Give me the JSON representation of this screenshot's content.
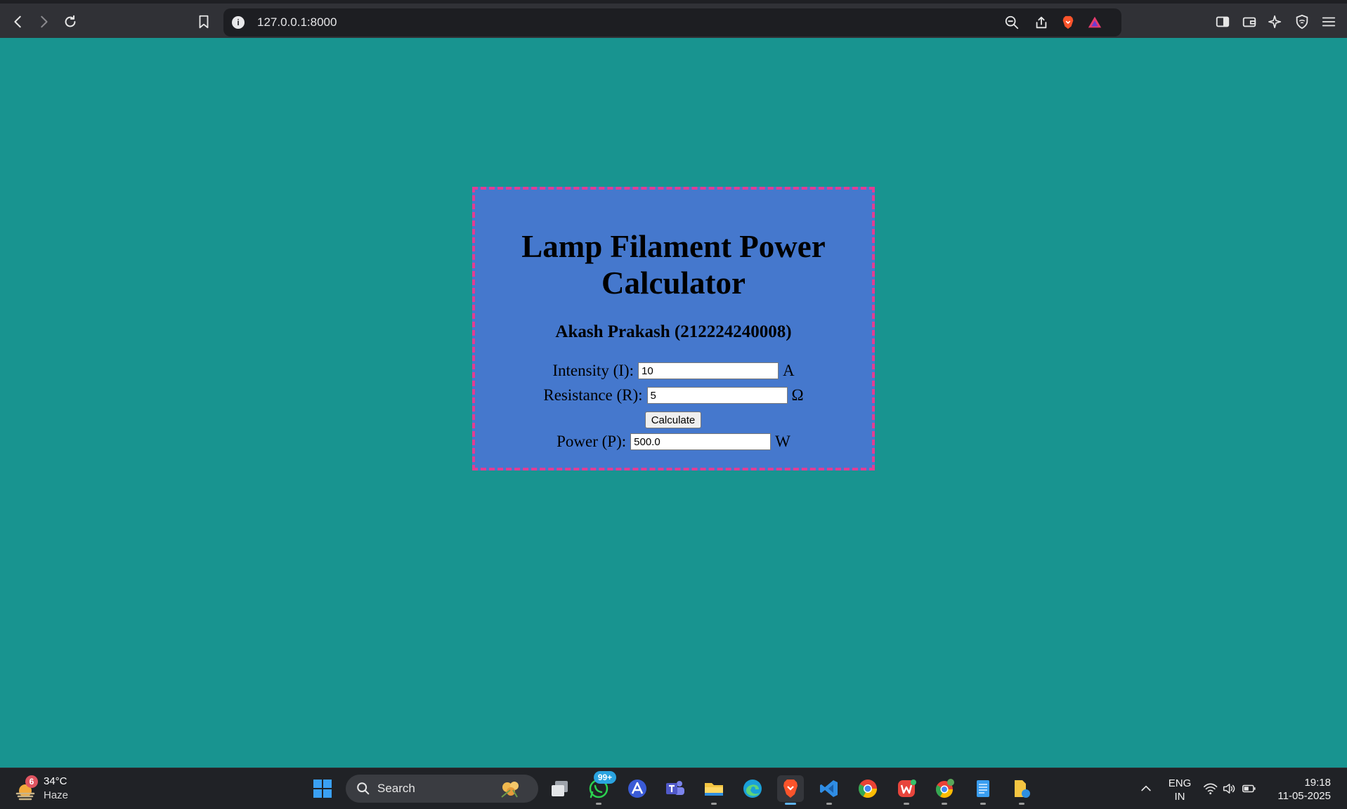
{
  "browser": {
    "url": "127.0.0.1:8000",
    "colors": {
      "frame": "#303136",
      "urlbar": "#1d1e22"
    }
  },
  "page": {
    "background": "#189490",
    "title": "Lamp Filament Power Calculator",
    "author": "Akash Prakash (212224240008)",
    "intensity": {
      "label": "Intensity (I):",
      "value": "10",
      "unit": "A"
    },
    "resistance": {
      "label": "Resistance (R):",
      "value": "5",
      "unit": "Ω"
    },
    "calculate_label": "Calculate",
    "power": {
      "label": "Power (P):",
      "value": "500.0",
      "unit": "W"
    },
    "colors": {
      "card": "#4578cd",
      "border": "#e23d93"
    }
  },
  "taskbar": {
    "weather": {
      "badge": "6",
      "temp": "34°C",
      "condition": "Haze"
    },
    "search_label": "Search",
    "whatsapp_badge": "99+",
    "language": {
      "line1": "ENG",
      "line2": "IN"
    },
    "clock": {
      "time": "19:18",
      "date": "11-05-2025"
    },
    "apps": [
      "task-view-icon",
      "whatsapp-icon",
      "arc-icon",
      "teams-icon",
      "file-explorer-icon",
      "edge-icon",
      "brave-icon",
      "vscode-icon",
      "chrome-icon",
      "wps-icon",
      "chrome-profile-icon",
      "notepad-icon",
      "files-icon"
    ]
  }
}
